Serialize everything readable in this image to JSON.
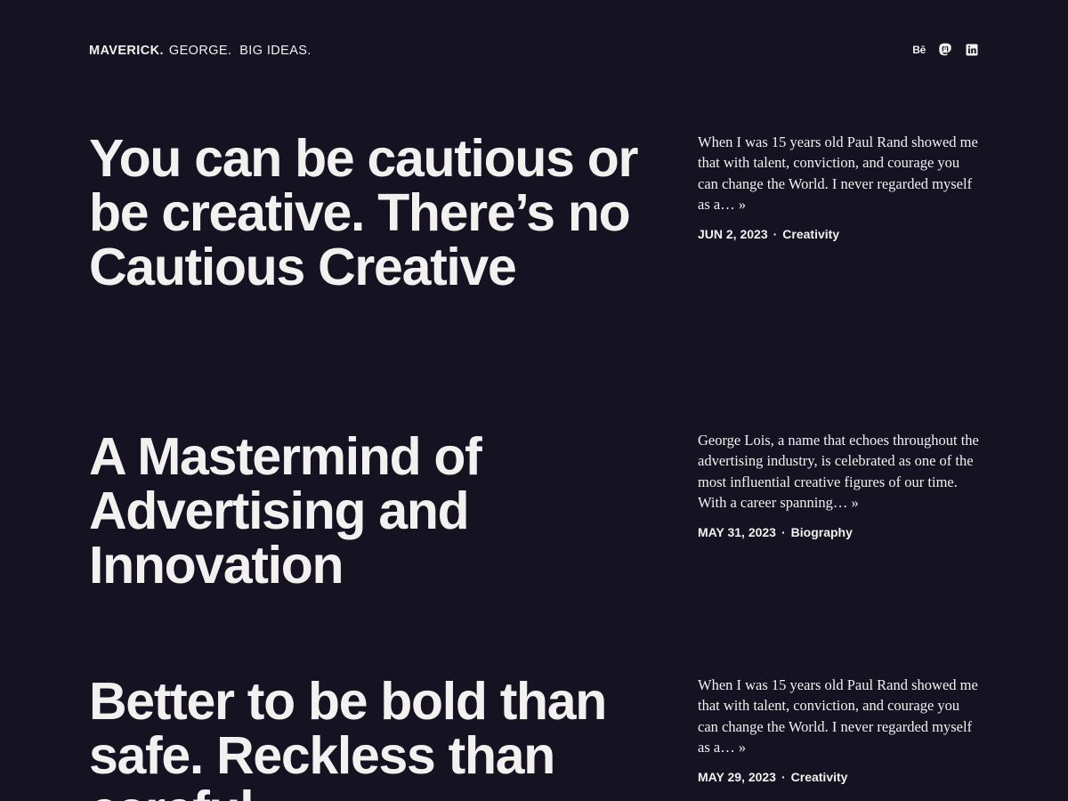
{
  "header": {
    "brand": "MAVERICK.",
    "tagline": "GEORGE.  BIG IDEAS.",
    "social": [
      {
        "name": "behance-icon",
        "label": "Bē"
      },
      {
        "name": "mastodon-icon"
      },
      {
        "name": "linkedin-icon"
      }
    ]
  },
  "posts": [
    {
      "title": "You can be cautious or be creative. There’s no Cautious Creative",
      "excerpt": "When I was 15 years old Paul Rand showed me that with talent, conviction, and courage you can change the World. I never regarded myself as a… »",
      "date": "JUN 2, 2023",
      "category": "Creativity"
    },
    {
      "title": "A Mastermind of Advertising and Innovation",
      "excerpt": "George Lois, a name that echoes throughout the advertising industry, is celebrated as one of the most influential creative figures of our time. With a career spanning… »",
      "date": "MAY 31, 2023",
      "category": "Biography"
    },
    {
      "title": "Better to be bold than safe. Reckless than careful.",
      "excerpt": "When I was 15 years old Paul Rand showed me that with talent, conviction, and courage you can change the World. I never regarded myself as a… »",
      "date": "MAY 29, 2023",
      "category": "Creativity"
    }
  ],
  "meta_separator": "·",
  "colors": {
    "background": "#151221",
    "text": "#f2f1ef"
  }
}
